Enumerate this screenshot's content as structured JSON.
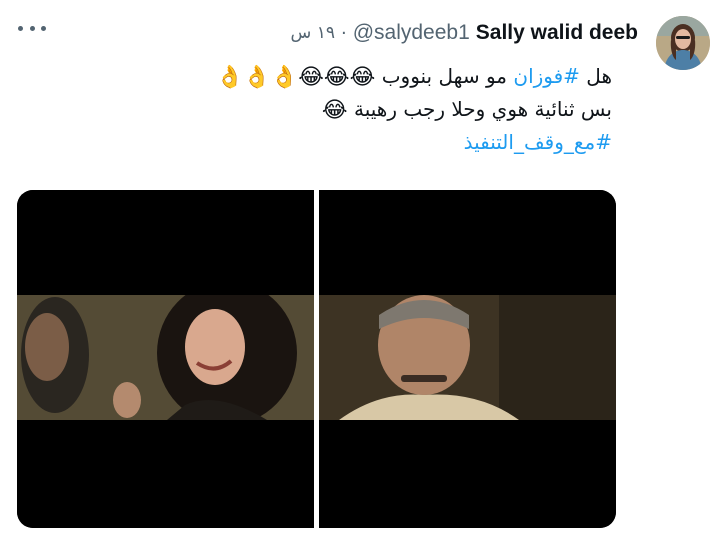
{
  "tweet": {
    "author_name": "Sally walid deeb",
    "author_handle": "@salydeeb1",
    "separator": "·",
    "time": "١٩ س",
    "line1_prefix": "هل ",
    "line1_hashtag": "#فوزان",
    "line1_text": " مو سهل بنووب",
    "line1_emojis": [
      "😂",
      "😂",
      "😂",
      "👌",
      "👌",
      "👌"
    ],
    "line2_text": "بس ثنائية هوي وحلا رجب رهيبة ",
    "line2_emojis": [
      "😂"
    ],
    "hashtag": "#مع_وقف_التنفيذ"
  },
  "media": {
    "images": [
      {
        "description": "woman with curly dark hair smiling at a man"
      },
      {
        "description": "older man with mustache looking up"
      }
    ]
  },
  "colors": {
    "link": "#1d9bf0",
    "secondary": "#536471",
    "primary_text": "#0f1419",
    "background": "#ffffff"
  },
  "icons": [
    "more-options-icon"
  ]
}
